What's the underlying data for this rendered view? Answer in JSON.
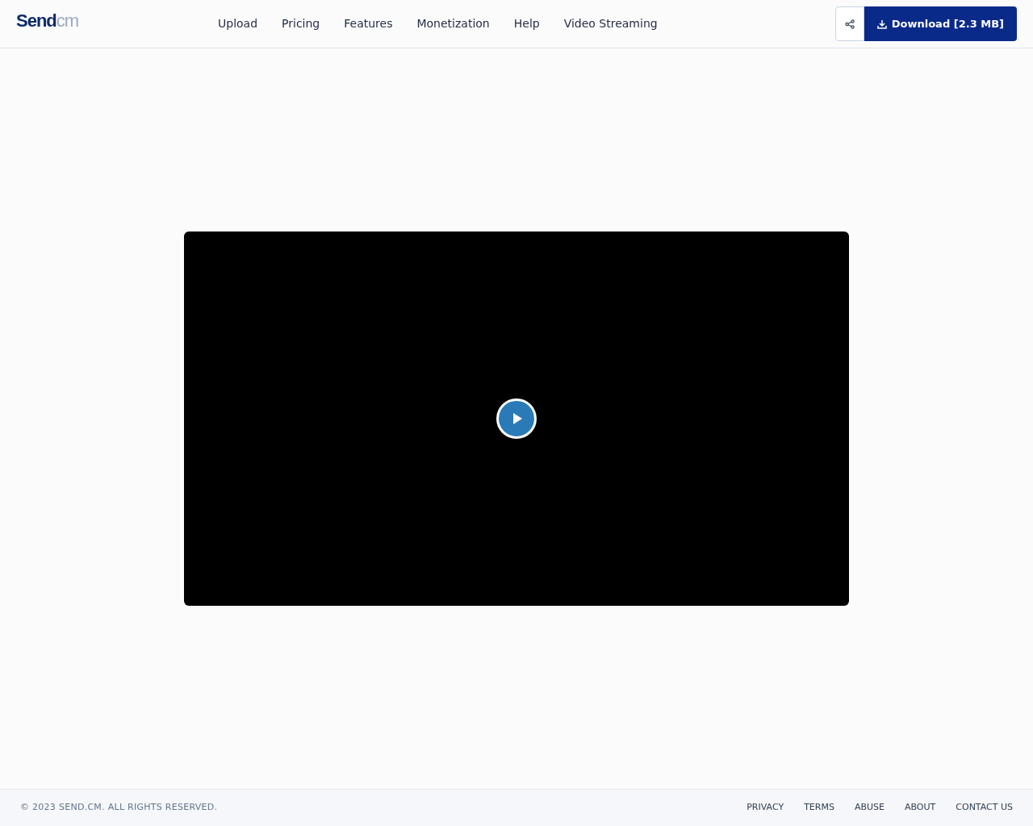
{
  "header": {
    "logo": {
      "main": "Send",
      "suffix": "cm"
    },
    "nav": [
      "Upload",
      "Pricing",
      "Features",
      "Monetization",
      "Help",
      "Video Streaming"
    ],
    "download_button": "Download [2.3 MB]"
  },
  "video": {
    "kind": "player"
  },
  "footer": {
    "copyright": "© 2023 SEND.CM. ALL RIGHTS RESERVED.",
    "links": [
      "PRIVACY",
      "TERMS",
      "ABUSE",
      "ABOUT",
      "CONTACT US"
    ]
  }
}
